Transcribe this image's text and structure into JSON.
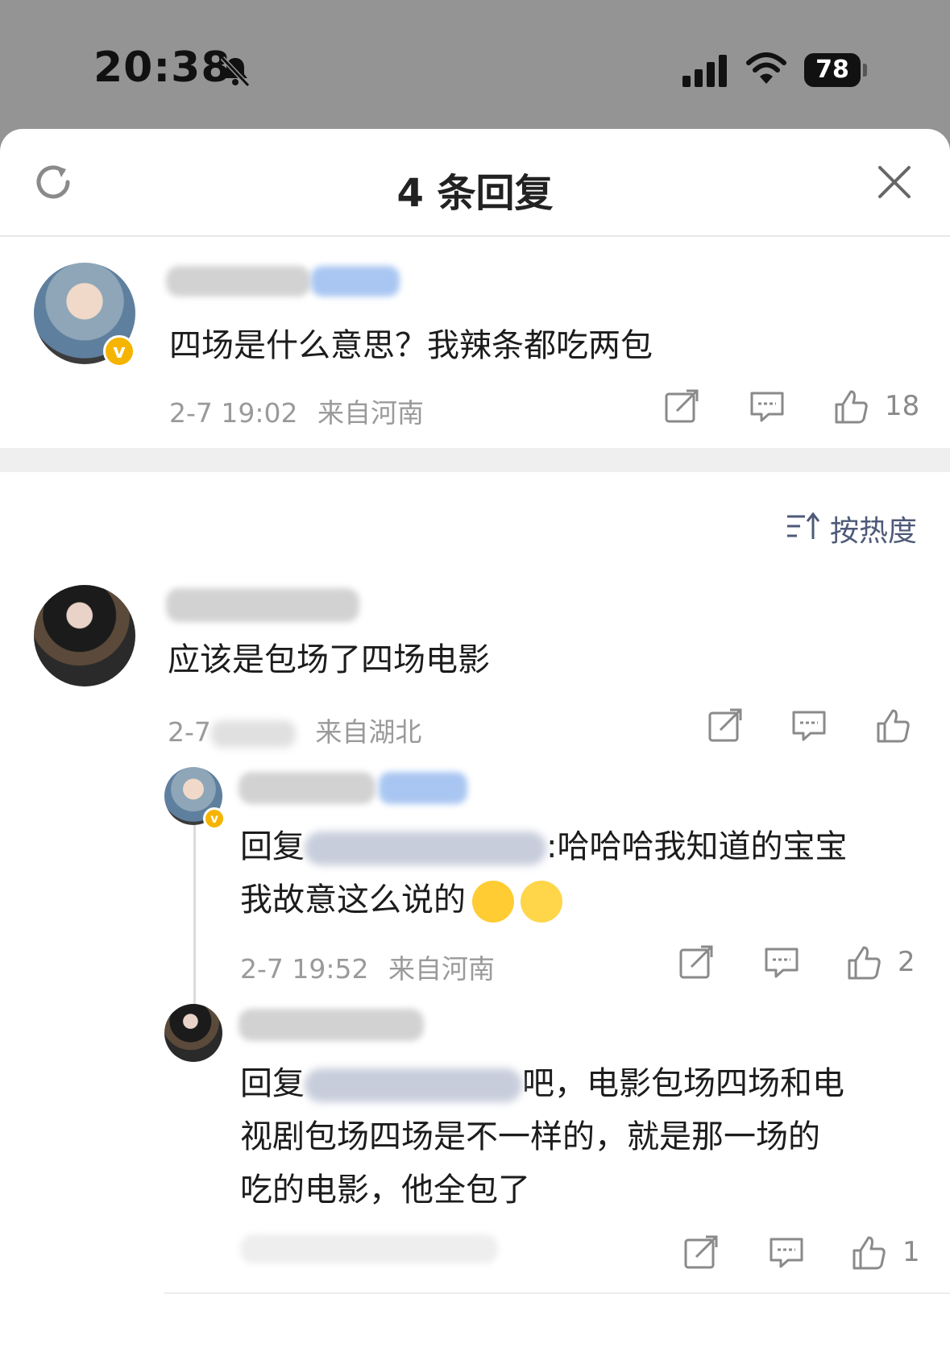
{
  "status_bar": {
    "time": "20:38",
    "battery": "78",
    "icons": [
      "bell-slash-icon",
      "cellular-signal-icon",
      "wifi-icon",
      "battery-icon"
    ]
  },
  "sheet": {
    "title": "4 条回复",
    "icons": [
      "refresh-icon",
      "close-icon"
    ]
  },
  "main_comment": {
    "text": "四场是什么意思？我辣条都吃两包",
    "time": "2-7 19:02",
    "location": "来自河南",
    "likes": "18",
    "verified_mark": "v"
  },
  "sort": {
    "label": "按热度",
    "icon": "sort-icon"
  },
  "replies": [
    {
      "text": "应该是包场了四场电影",
      "time_prefix": "2-7",
      "location": "来自湖北",
      "likes": ""
    },
    {
      "reply_prefix": "回复",
      "text_after": ":哈哈哈我知道的宝宝",
      "text_line2": "我故意这么说的",
      "emojis": [
        "loudly-crying-face-emoji",
        "grinning-face-emoji"
      ],
      "time": "2-7 19:52",
      "location": "来自河南",
      "likes": "2",
      "verified_mark": "v"
    },
    {
      "reply_prefix": "回复",
      "text_after": "吧，电影包场四场和电",
      "text_line2": "视剧包场四场是不一样的，就是那一场的",
      "text_line3": "吃的电影，他全包了",
      "likes": "1"
    }
  ],
  "colors": {
    "accent_blue": "#4e5a78",
    "verified_gold": "#f5b400",
    "meta_grey": "#9a9a9a",
    "backdrop": "#949494"
  }
}
